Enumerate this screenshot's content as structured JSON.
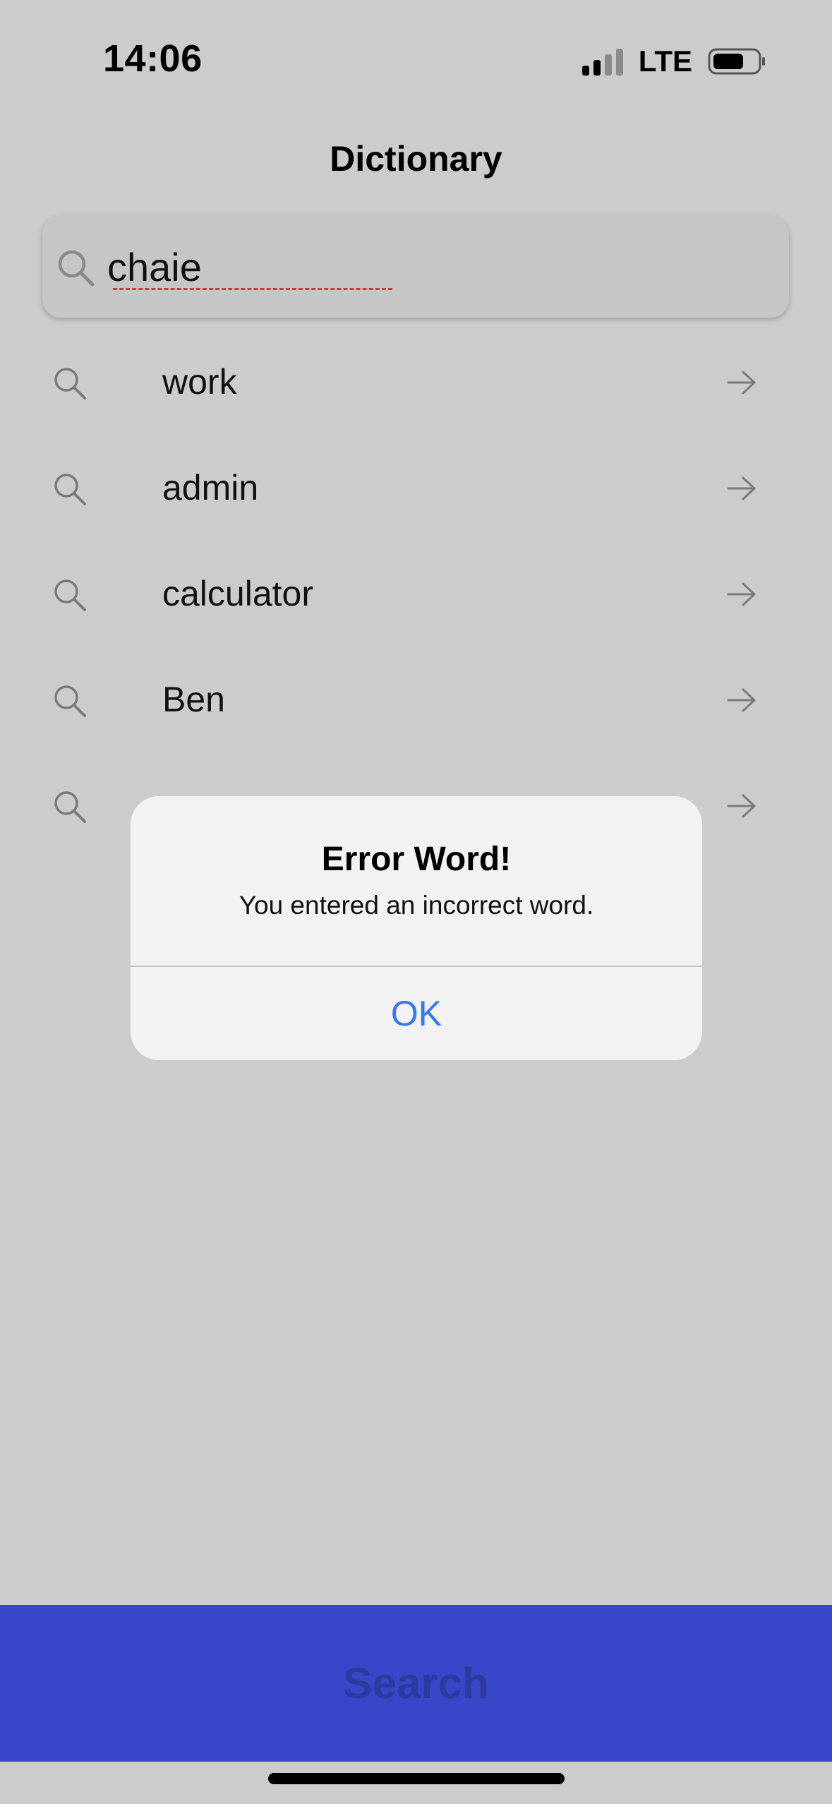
{
  "status_bar": {
    "time": "14:06",
    "network": "LTE",
    "signal_icon": "signal-bars-icon",
    "battery_icon": "battery-icon"
  },
  "header": {
    "title": "Dictionary"
  },
  "search": {
    "value": "chaie",
    "icon": "search-icon"
  },
  "suggestions": [
    {
      "label": "work",
      "icon": "search-icon",
      "trailing_icon": "arrow-right-icon"
    },
    {
      "label": "admin",
      "icon": "search-icon",
      "trailing_icon": "arrow-right-icon"
    },
    {
      "label": "calculator",
      "icon": "search-icon",
      "trailing_icon": "arrow-right-icon"
    },
    {
      "label": "Ben",
      "icon": "search-icon",
      "trailing_icon": "arrow-right-icon"
    },
    {
      "label": "",
      "icon": "search-icon",
      "trailing_icon": "arrow-right-icon"
    }
  ],
  "alert": {
    "title": "Error Word!",
    "message": "You entered an incorrect word.",
    "ok_label": "OK"
  },
  "footer": {
    "search_label": "Search"
  },
  "colors": {
    "background": "#cccccc",
    "alert_background": "#f2f2f2",
    "alert_button": "#3478f6",
    "search_bar": "#3847c7",
    "search_label": "#2e3aa0",
    "spell_error": "#e0303a"
  }
}
